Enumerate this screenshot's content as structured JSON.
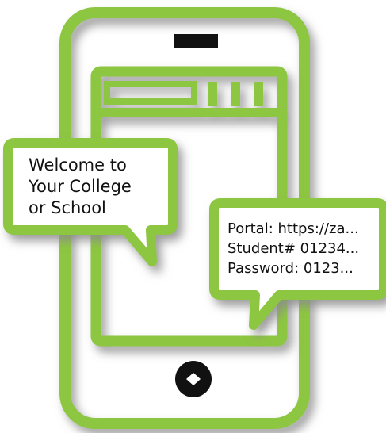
{
  "welcome_bubble": {
    "lines": [
      "Welcome to",
      "Your College",
      "or School"
    ]
  },
  "credentials_bubble": {
    "portal": "Portal: https://za...",
    "student": "Student# 01234...",
    "password": "Password: 0123..."
  },
  "colors": {
    "accent_green": "#8dc63f",
    "shadow": "#9a9a9a",
    "text": "#111111",
    "speaker": "#111111"
  },
  "icons": {
    "phone": "smartphone-icon",
    "home_button": "home-button-icon",
    "speaker": "speaker-slot-icon"
  }
}
